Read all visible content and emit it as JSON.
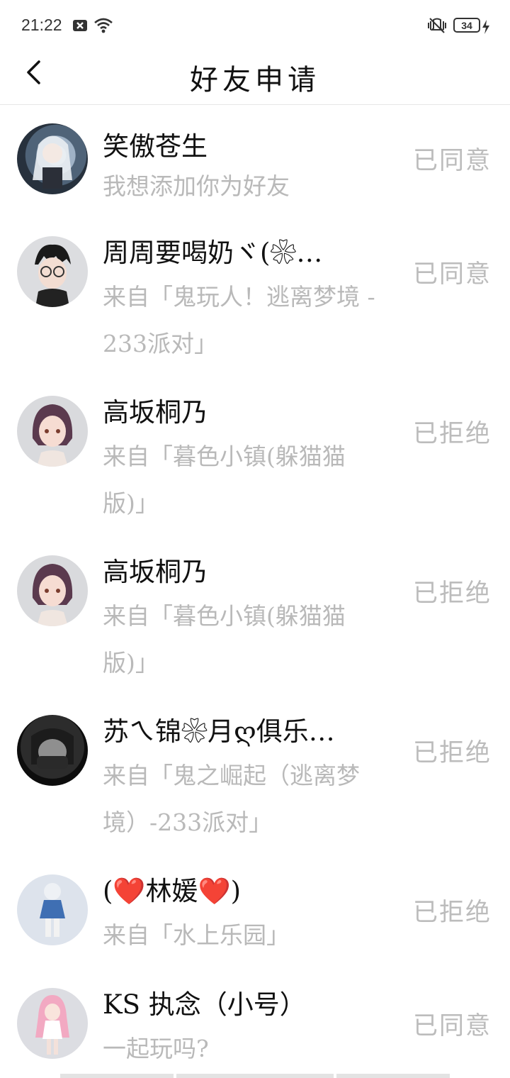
{
  "status_bar": {
    "time": "21:22",
    "battery": "34",
    "icons": [
      "close-notification-icon",
      "wifi-icon",
      "vibrate-icon",
      "battery-icon",
      "charging-icon"
    ]
  },
  "header": {
    "title": "好友申请",
    "back_icon": "chevron-left-icon"
  },
  "requests": [
    {
      "name": "笑傲苍生",
      "message": "我想添加你为好友",
      "status": "已同意",
      "avatar": "avatar-anime-white-hair"
    },
    {
      "name": "周周要喝奶ヾ(❀…",
      "message": "来自「鬼玩人！逃离梦境 - 233派对」",
      "status": "已同意",
      "avatar": "avatar-glasses-boy"
    },
    {
      "name": "高坂桐乃",
      "message": "来自「暮色小镇(躲猫猫版)」",
      "status": "已拒绝",
      "avatar": "avatar-purple-hair-girl"
    },
    {
      "name": "高坂桐乃",
      "message": "来自「暮色小镇(躲猫猫版)」",
      "status": "已拒绝",
      "avatar": "avatar-purple-hair-girl"
    },
    {
      "name": "苏ㄟ锦❀月ღ俱乐…",
      "message": "来自「鬼之崛起（逃离梦境）-233派对」",
      "status": "已拒绝",
      "avatar": "avatar-dark-photo"
    },
    {
      "name": "(❤️林媛❤️)",
      "message": "来自「水上乐园」",
      "status": "已拒绝",
      "avatar": "avatar-white-hair-figure"
    },
    {
      "name": "KS 执念（小号）",
      "message": "一起玩吗?",
      "status": "已同意",
      "avatar": "avatar-pink-hair-figure"
    }
  ],
  "colors": {
    "title": "#111111",
    "secondary_text": "#b9b9b9",
    "status_text": "#bcbcbc",
    "divider": "#e6e6e6"
  }
}
